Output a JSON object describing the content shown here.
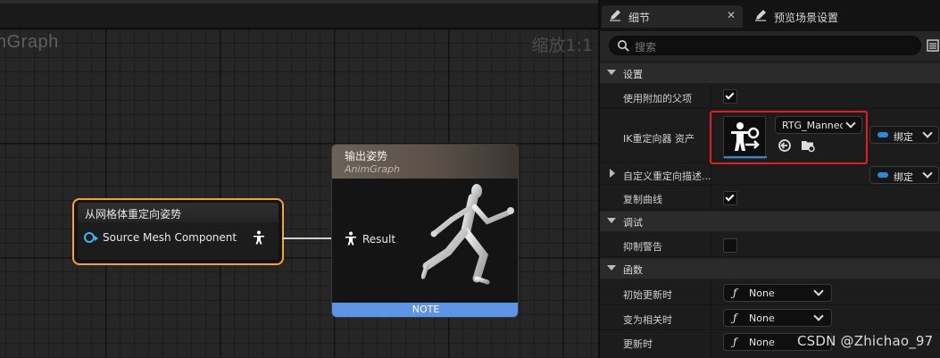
{
  "graph": {
    "title": "nGraph",
    "zoom_label": "缩放1:1",
    "retarget_node": {
      "title": "从网格体重定向姿势",
      "pin_label": "Source Mesh Component"
    },
    "output_node": {
      "title": "输出姿势",
      "subtitle": "AnimGraph",
      "pin_label": "Result",
      "note_label": "NOTE"
    }
  },
  "details": {
    "tabs": [
      {
        "label": "细节",
        "close": "✕"
      },
      {
        "label": "预览场景设置"
      }
    ],
    "search": {
      "placeholder": "搜索"
    },
    "sections": {
      "settings": "设置",
      "debug": "调试",
      "functions": "函数"
    },
    "rows": {
      "use_attached_parent": {
        "label": "使用附加的父项",
        "checked": true
      },
      "ik_retargeter_asset": {
        "label": "IK重定向器 资产",
        "value": "RTG_Mannequin",
        "bind": "绑定"
      },
      "custom_retarget_desc": {
        "label": "自定义重定向描述...",
        "bind": "绑定"
      },
      "copy_curves": {
        "label": "复制曲线",
        "checked": true
      },
      "suppress_warnings": {
        "label": "抑制警告",
        "checked": false
      },
      "initial_update": {
        "label": "初始更新时",
        "value": "None"
      },
      "became_relevant": {
        "label": "变为相关时",
        "value": "None"
      },
      "on_update": {
        "label": "更新时",
        "value": "None"
      }
    }
  },
  "watermark": "CSDN @Zhichao_97",
  "colors": {
    "selection_orange": "#f4a622",
    "highlight_red": "#e02020",
    "accent_blue": "#2a8bd8",
    "note_blue": "#5e94e8"
  }
}
